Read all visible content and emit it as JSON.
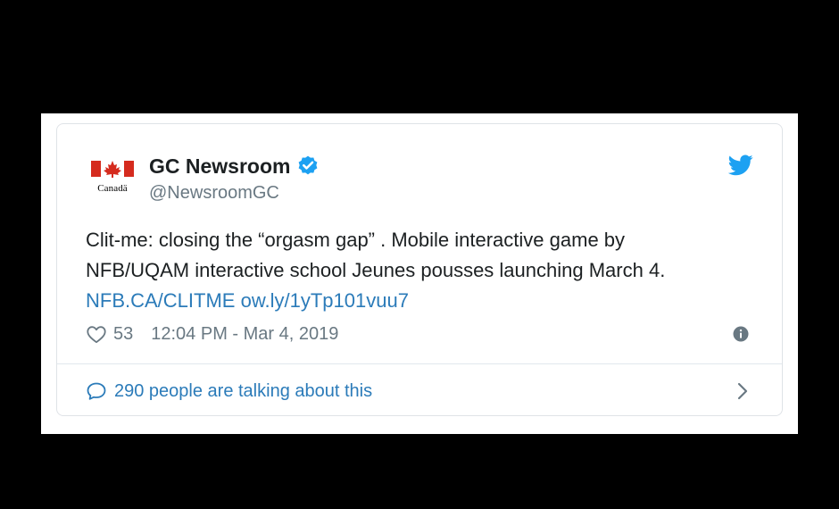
{
  "account": {
    "name": "GC Newsroom",
    "handle": "@NewsroomGC",
    "logo_wordmark": "Canadä",
    "verified_icon": "verified-badge-icon",
    "platform_icon": "twitter-bird-icon"
  },
  "tweet": {
    "text_line1": "Clit-me: closing the “orgasm gap” . Mobile interactive game by",
    "text_line2": "NFB/UQAM interactive school Jeunes pousses launching March 4.",
    "link1": "NFB.CA/CLITME",
    "link2": "ow.ly/1yTp101vuu7"
  },
  "meta": {
    "like_count": "53",
    "timestamp": "12:04 PM - Mar 4, 2019"
  },
  "footer": {
    "talking_label": "290 people are talking about this"
  },
  "colors": {
    "link": "#2b7bb9",
    "text": "#1c2022",
    "secondary": "#697882",
    "verified": "#1da1f2",
    "flag_red": "#d52b1e"
  }
}
